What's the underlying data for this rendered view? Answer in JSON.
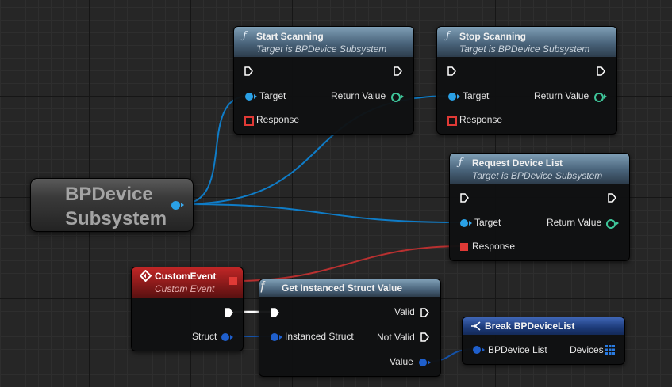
{
  "nodes": {
    "start_scanning": {
      "title": "Start Scanning",
      "subtitle": "Target is BPDevice Subsystem",
      "target": "Target",
      "return_value": "Return Value",
      "response": "Response"
    },
    "stop_scanning": {
      "title": "Stop Scanning",
      "subtitle": "Target is BPDevice Subsystem",
      "target": "Target",
      "return_value": "Return Value",
      "response": "Response"
    },
    "request_device_list": {
      "title": "Request Device List",
      "subtitle": "Target is BPDevice Subsystem",
      "target": "Target",
      "return_value": "Return Value",
      "response": "Response"
    },
    "bpdevice_subsystem": {
      "title": "BPDevice Subsystem"
    },
    "custom_event": {
      "title": "CustomEvent",
      "subtitle": "Custom Event",
      "struct": "Struct"
    },
    "get_instanced_struct_value": {
      "title": "Get Instanced Struct Value",
      "instanced_struct": "Instanced Struct",
      "valid": "Valid",
      "not_valid": "Not Valid",
      "value": "Value"
    },
    "break_bpdevicelist": {
      "title": "Break BPDeviceList",
      "bpdevice_list": "BPDevice List",
      "devices": "Devices"
    }
  },
  "icons": {
    "function": "function-icon",
    "event": "event-diamond-icon",
    "break": "break-struct-icon",
    "exec": "exec-pin-icon",
    "array": "array-grid-icon"
  },
  "colors": {
    "object_pin": "#2aa1e6",
    "struct_pin": "#1f5fcc",
    "delegate_pin": "#e03a36",
    "return_pin": "#3fc79b",
    "function_header": "#5a7892",
    "event_header": "#9a1c1c",
    "break_header": "#1c3a78",
    "object_wire": "#0f7cc7",
    "struct_wire": "#1452a8",
    "delegate_wire": "#b83030",
    "exec_wire": "#ffffff"
  }
}
